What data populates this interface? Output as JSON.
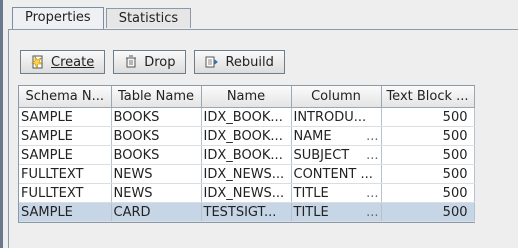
{
  "tabs": [
    {
      "label": "Properties"
    },
    {
      "label": "Statistics"
    }
  ],
  "toolbar": {
    "create_label": "Create",
    "drop_label": "Drop",
    "rebuild_label": "Rebuild"
  },
  "table": {
    "headers": [
      "Schema N...",
      "Table Name",
      "Name",
      "Column",
      "Text Block ..."
    ],
    "rows": [
      [
        "SAMPLE",
        "BOOKS",
        "IDX_BOOK...",
        "INTRODU...",
        "500"
      ],
      [
        "SAMPLE",
        "BOOKS",
        "IDX_BOOK...",
        "NAME",
        "500"
      ],
      [
        "SAMPLE",
        "BOOKS",
        "IDX_BOOK...",
        "SUBJECT",
        "500"
      ],
      [
        "FULLTEXT",
        "NEWS",
        "IDX_NEWS...",
        "CONTENT ...",
        "500"
      ],
      [
        "FULLTEXT",
        "NEWS",
        "IDX_NEWS...",
        "TITLE",
        "500"
      ],
      [
        "SAMPLE",
        "CARD",
        "TESTSIGT...",
        "TITLE",
        "500"
      ]
    ],
    "ellipsis": "..."
  }
}
